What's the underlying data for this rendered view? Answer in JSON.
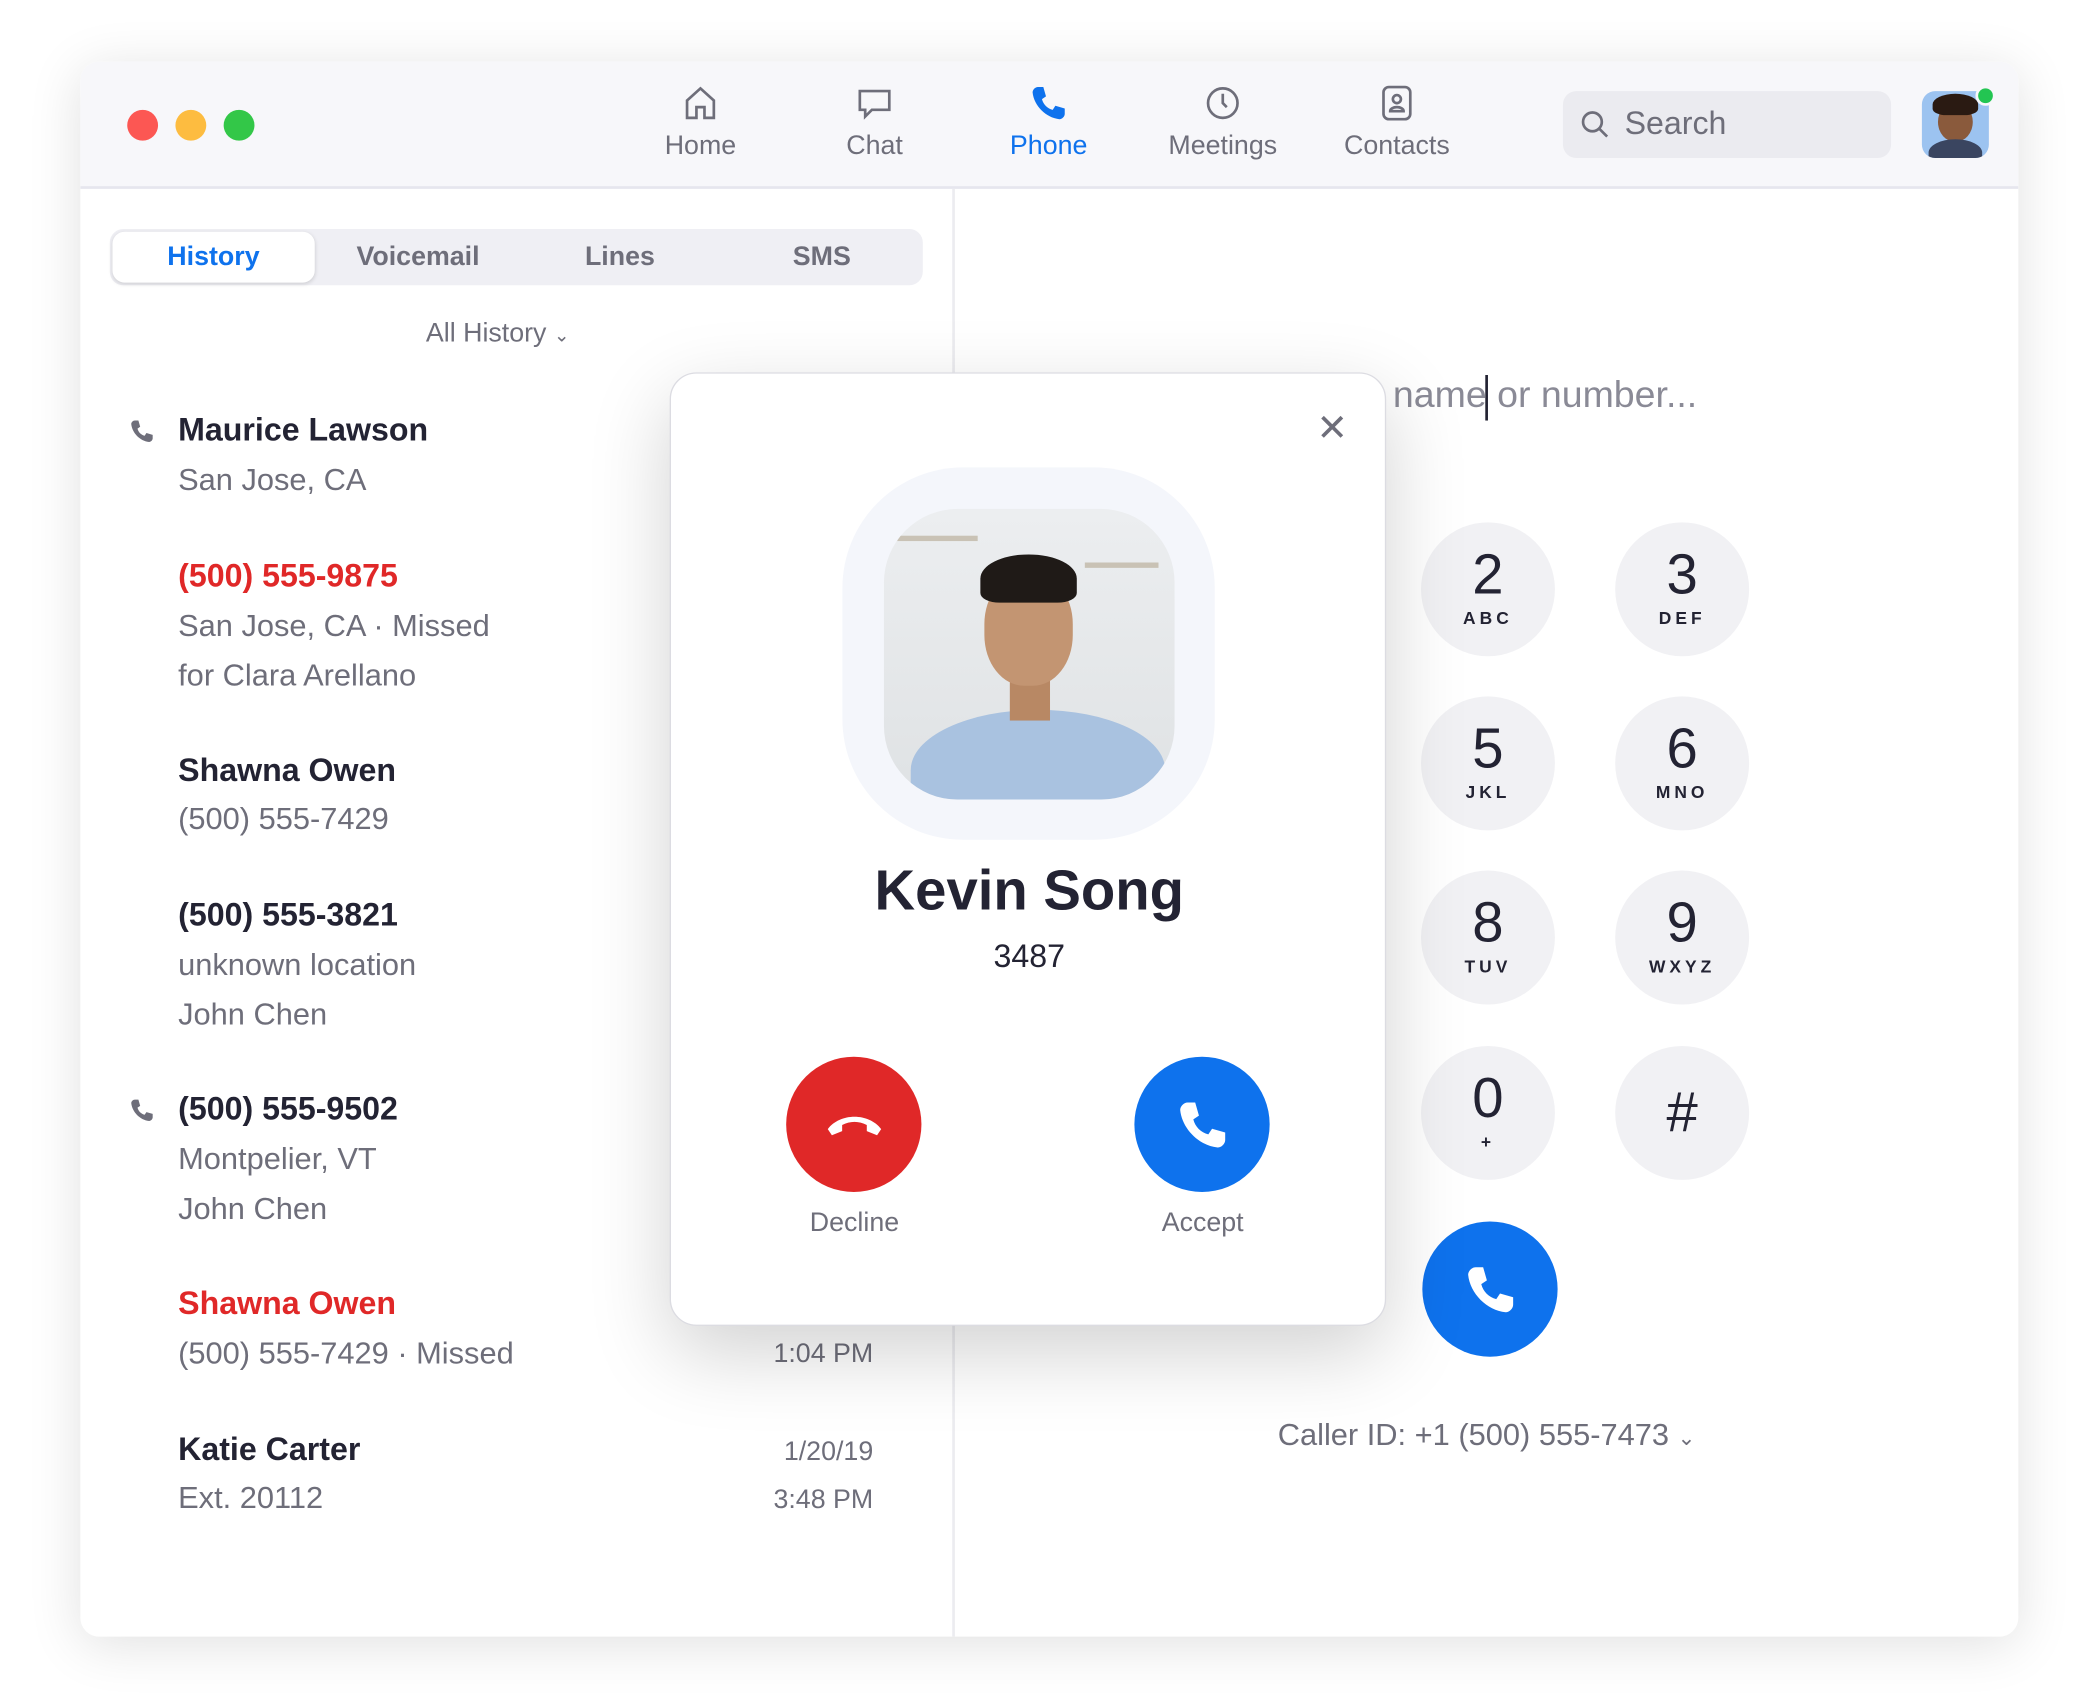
{
  "nav": {
    "items": [
      {
        "label": "Home",
        "icon": "home-icon"
      },
      {
        "label": "Chat",
        "icon": "chat-icon"
      },
      {
        "label": "Phone",
        "icon": "phone-icon",
        "active": true
      },
      {
        "label": "Meetings",
        "icon": "clock-icon"
      },
      {
        "label": "Contacts",
        "icon": "contacts-icon"
      }
    ],
    "search_placeholder": "Search"
  },
  "tabs": [
    "History",
    "Voicemail",
    "Lines",
    "SMS"
  ],
  "filter": "All History",
  "history": [
    {
      "name": "Maurice Lawson",
      "lines": [
        "San Jose, CA"
      ],
      "icon": true
    },
    {
      "name": "(500) 555-9875",
      "missed": true,
      "lines": [
        "San Jose, CA · Missed",
        "for Clara Arellano"
      ]
    },
    {
      "name": "Shawna Owen",
      "lines": [
        "(500) 555-7429"
      ]
    },
    {
      "name": "(500) 555-3821",
      "lines": [
        "unknown location",
        "John Chen"
      ]
    },
    {
      "name": "(500) 555-9502",
      "lines": [
        "Montpelier, VT",
        "John Chen"
      ],
      "icon": true
    },
    {
      "name": "Shawna Owen",
      "missed": true,
      "lines": [
        "(500) 555-7429 · Missed"
      ],
      "time": "1:04 PM"
    },
    {
      "name": "Katie Carter",
      "lines": [
        "Ext. 20112"
      ],
      "date": "1/20/19",
      "time": "3:48 PM"
    }
  ],
  "dialer": {
    "input_visible_text": "name or number...",
    "keys": [
      {
        "digit": "2",
        "letters": "ABC"
      },
      {
        "digit": "3",
        "letters": "DEF"
      },
      {
        "digit": "5",
        "letters": "JKL"
      },
      {
        "digit": "6",
        "letters": "MNO"
      },
      {
        "digit": "8",
        "letters": "TUV"
      },
      {
        "digit": "9",
        "letters": "WXYZ"
      },
      {
        "digit": "0",
        "letters": "+"
      },
      {
        "digit": "#",
        "letters": ""
      }
    ],
    "caller_id": "Caller ID: +1 (500) 555-7473"
  },
  "incoming_call": {
    "name": "Kevin Song",
    "extension": "3487",
    "decline_label": "Decline",
    "accept_label": "Accept"
  },
  "colors": {
    "accent": "#0e72ed",
    "missed": "#e02828",
    "online": "#23c552"
  }
}
